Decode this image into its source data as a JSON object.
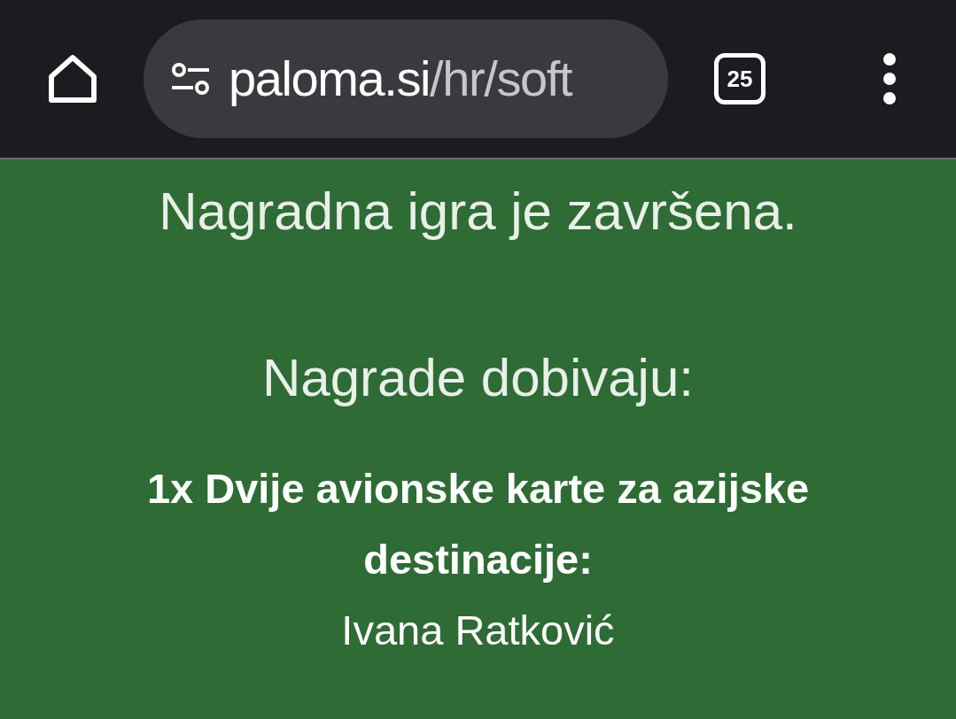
{
  "browser_bar": {
    "url": {
      "host": "paloma.si",
      "path": "/hr/soft"
    },
    "tab_count": "25"
  },
  "content": {
    "heading": "Nagradna igra je završena.",
    "subheading": "Nagrade dobivaju:",
    "prizes": [
      {
        "title": "1x Dvije avionske karte za azijske destinacije:",
        "winner": "Ivana Ratković"
      }
    ]
  }
}
